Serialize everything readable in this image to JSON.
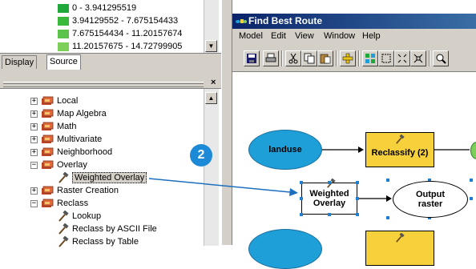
{
  "legend": {
    "items": [
      {
        "label": "0 - 3.941295519",
        "color": "#1fa83a"
      },
      {
        "label": "3.94129552 - 7.675154433",
        "color": "#3ab83a"
      },
      {
        "label": "7.675154434 - 11.20157674",
        "color": "#5cc34a"
      },
      {
        "label": "11.20157675 - 14.72799905",
        "color": "#7cd05a"
      }
    ]
  },
  "tabs": [
    {
      "label": "Display",
      "active": false
    },
    {
      "label": "Source",
      "active": true
    }
  ],
  "toolbox_tree": {
    "items": [
      {
        "label": "Local",
        "type": "toolset",
        "expander": "+"
      },
      {
        "label": "Map Algebra",
        "type": "toolset",
        "expander": "+"
      },
      {
        "label": "Math",
        "type": "toolset",
        "expander": "+"
      },
      {
        "label": "Multivariate",
        "type": "toolset",
        "expander": "+"
      },
      {
        "label": "Neighborhood",
        "type": "toolset",
        "expander": "+"
      },
      {
        "label": "Overlay",
        "type": "toolset",
        "expander": "−"
      },
      {
        "label": "Weighted Overlay",
        "type": "tool",
        "selected": true
      },
      {
        "label": "Raster Creation",
        "type": "toolset",
        "expander": "+"
      },
      {
        "label": "Reclass",
        "type": "toolset",
        "expander": "−"
      },
      {
        "label": "Lookup",
        "type": "tool"
      },
      {
        "label": "Reclass by ASCII File",
        "type": "tool"
      },
      {
        "label": "Reclass by Table",
        "type": "tool"
      }
    ]
  },
  "window": {
    "title": "Find Best Route",
    "menu": [
      "Model",
      "Edit",
      "View",
      "Window",
      "Help"
    ]
  },
  "toolbar_icons": [
    "save-icon",
    "print-icon",
    "cut-icon",
    "copy-icon",
    "paste-icon",
    "add-data-icon",
    "grid-layout-icon",
    "full-extent-icon",
    "zoom-in-fixed-icon",
    "zoom-out-fixed-icon",
    "zoom-icon"
  ],
  "model": {
    "landuse": "landuse",
    "reclassify": "Reclassify (2)",
    "weighted_overlay_line1": "Weighted",
    "weighted_overlay_line2": "Overlay",
    "output_line1": "Output",
    "output_line2": "raster"
  },
  "callout": "2",
  "colors": {
    "input_data": "#1e9fd8",
    "tool": "#f7d13c",
    "connector": "#1c6fbf",
    "callout": "#1c8ad6"
  }
}
